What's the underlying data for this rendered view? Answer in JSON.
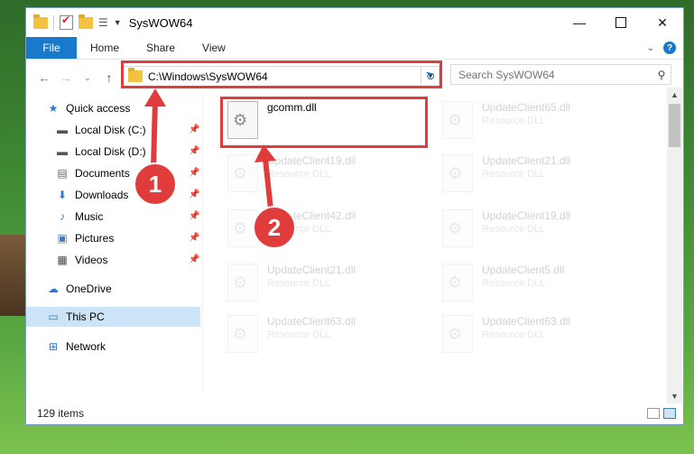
{
  "window": {
    "title": "SysWOW64",
    "controls": [
      "minimize-icon",
      "maximize-icon",
      "close-icon"
    ]
  },
  "ribbon": {
    "file_tab": "File",
    "tabs": [
      "Home",
      "Share",
      "View"
    ]
  },
  "nav": {
    "address": "C:\\Windows\\SysWOW64",
    "search_placeholder": "Search SysWOW64"
  },
  "sidebar": {
    "items": [
      {
        "label": "Quick access",
        "icon": "star-icon",
        "pinned": false
      },
      {
        "label": "Local Disk (C:)",
        "icon": "drive-icon",
        "pinned": true
      },
      {
        "label": "Local Disk (D:)",
        "icon": "drive-icon",
        "pinned": true
      },
      {
        "label": "Documents",
        "icon": "document-icon",
        "pinned": true
      },
      {
        "label": "Downloads",
        "icon": "download-icon",
        "pinned": true
      },
      {
        "label": "Music",
        "icon": "music-icon",
        "pinned": true
      },
      {
        "label": "Pictures",
        "icon": "picture-icon",
        "pinned": true
      },
      {
        "label": "Videos",
        "icon": "video-icon",
        "pinned": true
      },
      {
        "label": "OneDrive",
        "icon": "cloud-icon",
        "pinned": false
      },
      {
        "label": "This PC",
        "icon": "computer-icon",
        "pinned": false,
        "selected": true
      },
      {
        "label": "Network",
        "icon": "network-icon",
        "pinned": false
      }
    ]
  },
  "files": [
    {
      "name": "gcomm.dll",
      "type": ""
    },
    {
      "name": "UpdateClient65.dll",
      "type": "Resource DLL"
    },
    {
      "name": "UpdateClient19.dll",
      "type": "Resource DLL"
    },
    {
      "name": "UpdateClient21.dll",
      "type": "Resource DLL"
    },
    {
      "name": "UpdateClient42.dll",
      "type": "Resource DLL"
    },
    {
      "name": "UpdateClient19.dll",
      "type": "Resource DLL"
    },
    {
      "name": "UpdateClient21.dll",
      "type": "Resource DLL"
    },
    {
      "name": "UpdateClient5.dll",
      "type": "Resource DLL"
    },
    {
      "name": "UpdateClient63.dll",
      "type": "Resource DLL"
    },
    {
      "name": "UpdateClient63.dll",
      "type": "Resource DLL"
    }
  ],
  "status": {
    "item_count": "129 items"
  },
  "annotations": {
    "marker_1": "1",
    "marker_2": "2",
    "color": "#e03c3c"
  }
}
